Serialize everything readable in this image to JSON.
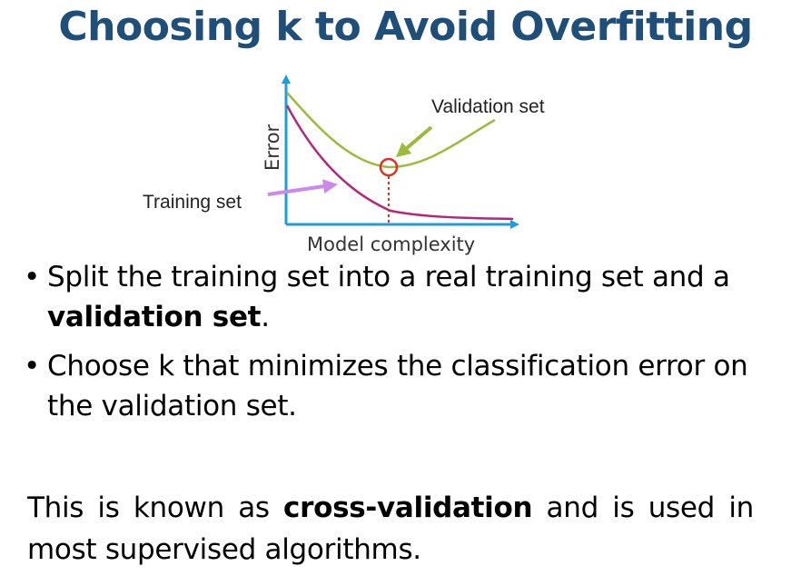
{
  "title": "Choosing k to Avoid Overfitting",
  "figure": {
    "ylabel": "Error",
    "xlabel": "Model complexity",
    "validation_label": "Validation set",
    "training_label": "Training set",
    "colors": {
      "axis": "#1aa0d8",
      "validation": "#9bbb3a",
      "training": "#b3287a",
      "marker": "#e03020",
      "training_arrow": "#cc88ee"
    }
  },
  "bullets": [
    {
      "bullet": "•",
      "pre": "Split the training set into a real training set and a ",
      "bold": "validation set",
      "post": "."
    },
    {
      "bullet": "•",
      "pre": "Choose k that minimizes the classification error on the validation set.",
      "bold": "",
      "post": ""
    }
  ],
  "closing": {
    "pre": "This is known as ",
    "bold": "cross-validation",
    "post": " and is used in most supervised algorithms."
  }
}
